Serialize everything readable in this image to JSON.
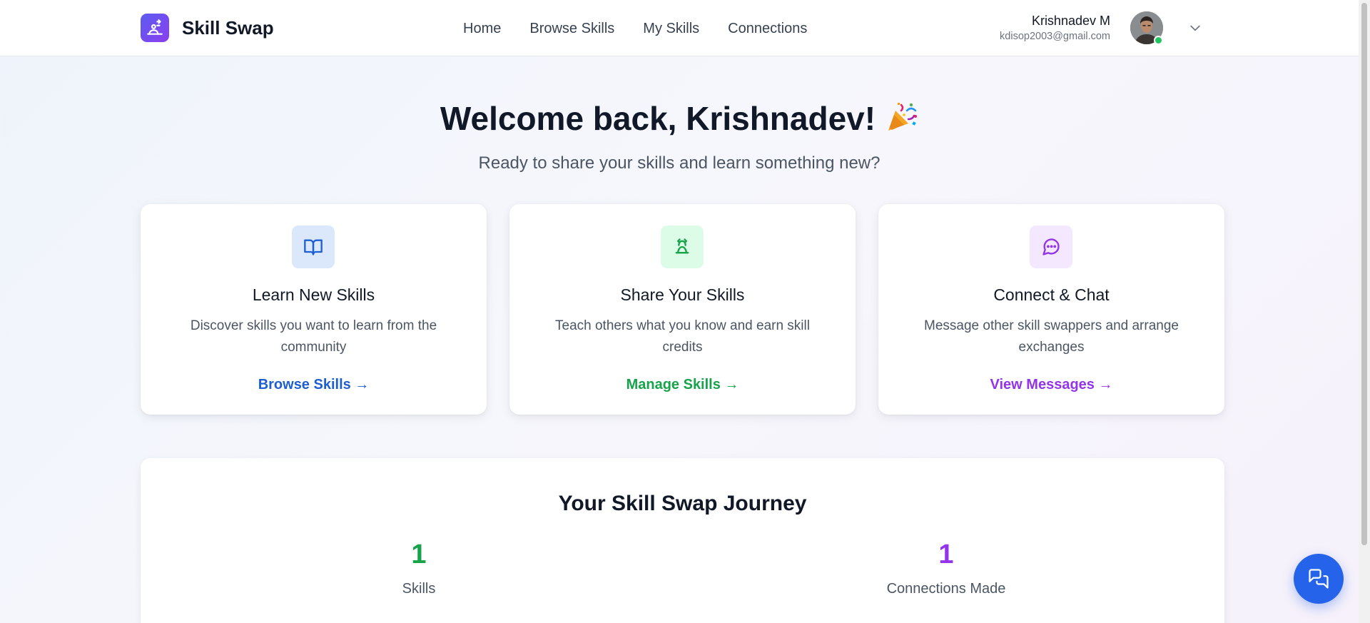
{
  "header": {
    "brand_name": "Skill Swap",
    "nav": [
      "Home",
      "Browse Skills",
      "My Skills",
      "Connections"
    ],
    "user": {
      "name": "Krishnadev M",
      "email": "kdisop2003@gmail.com",
      "status": "online"
    }
  },
  "hero": {
    "title": "Welcome back, Krishnadev!",
    "subtitle": "Ready to share your skills and learn something new?"
  },
  "cards": [
    {
      "icon": "book-open-icon",
      "title": "Learn New Skills",
      "description": "Discover skills you want to learn from the community",
      "link": "Browse Skills →",
      "accent": "#1d5fd1",
      "icon_bg": "#dbe8fb"
    },
    {
      "icon": "skill-share-icon",
      "title": "Share Your Skills",
      "description": "Teach others what you know and earn skill credits",
      "link": "Manage Skills →",
      "accent": "#16a34a",
      "icon_bg": "#dcfce7"
    },
    {
      "icon": "message-circle-icon",
      "title": "Connect & Chat",
      "description": "Message other skill swappers and arrange exchanges",
      "link": "View Messages →",
      "accent": "#9333ea",
      "icon_bg": "#f3e8ff"
    }
  ],
  "journey": {
    "title": "Your Skill Swap Journey",
    "stats": [
      {
        "value": "1",
        "label": "Skills",
        "color": "#16a34a"
      },
      {
        "value": "1",
        "label": "Connections Made",
        "color": "#9333ea"
      }
    ]
  },
  "colors": {
    "brand_gradient_start": "#5b5cf0",
    "brand_gradient_end": "#8b3ff0",
    "chat_fab": "#2563eb",
    "online": "#22c55e"
  }
}
